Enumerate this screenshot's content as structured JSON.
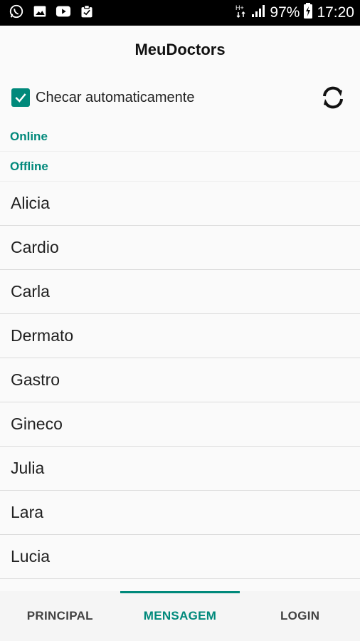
{
  "status_bar": {
    "battery_percent": "97%",
    "time": "17:20",
    "icons": [
      "whatsapp-icon",
      "gallery-icon",
      "youtube-icon",
      "clipboard-icon",
      "network-icon",
      "signal-icon",
      "battery-icon"
    ]
  },
  "app": {
    "title": "MeuDoctors"
  },
  "auto_check": {
    "label": "Checar automaticamente",
    "checked": true
  },
  "sections": {
    "online": "Online",
    "offline": "Offline"
  },
  "contacts": [
    "Alicia",
    "Cardio",
    "Carla",
    "Dermato",
    "Gastro",
    "Gineco",
    "Julia",
    "Lara",
    "Lucia"
  ],
  "tabs": [
    {
      "label": "PRINCIPAL",
      "active": false
    },
    {
      "label": "MENSAGEM",
      "active": true
    },
    {
      "label": "LOGIN",
      "active": false
    }
  ],
  "colors": {
    "accent": "#00897b",
    "status_bar": "#000000",
    "background": "#fafafa"
  }
}
